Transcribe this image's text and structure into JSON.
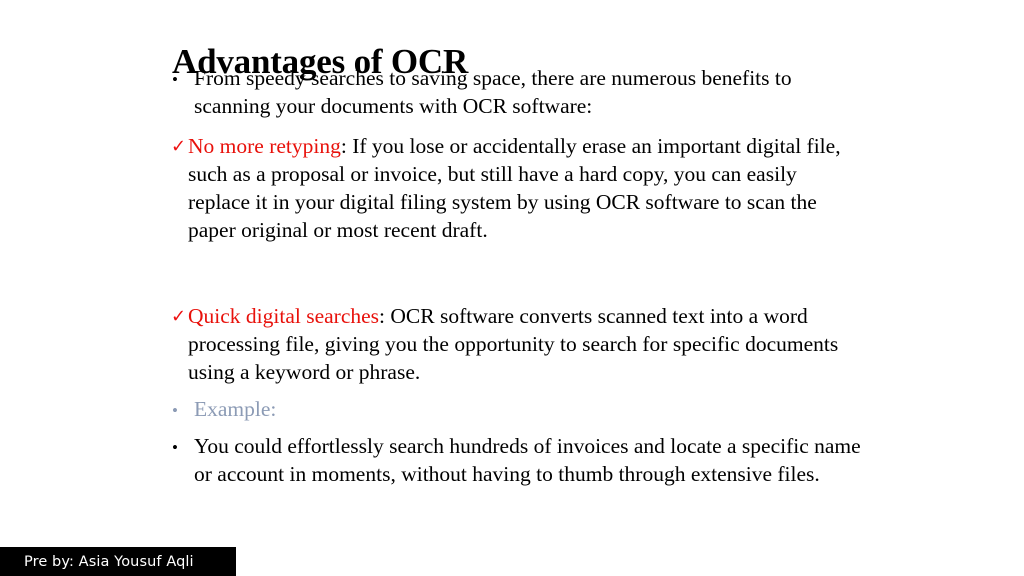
{
  "slide": {
    "title": "Advantages of OCR",
    "background_color": "#ffffff",
    "accent_red": "#e8110b",
    "muted_blue": "#8c9bb5"
  },
  "content": {
    "intro_bullet": {
      "marker": "dot-bullet",
      "text": "From speedy searches to saving space, there are numerous benefits to scanning your documents with OCR software:"
    },
    "point_one": {
      "marker": "check-bullet",
      "heading": "No more retyping",
      "separator": ": ",
      "text": "If you lose or accidentally erase an important digital file, such as a proposal or invoice, but still have a hard copy, you can easily replace it in your digital filing system by using OCR software to scan the paper original or most recent draft."
    },
    "point_two": {
      "marker": "check-bullet",
      "heading": "Quick digital searches",
      "separator": ": ",
      "text": "OCR software converts scanned text into a word processing file, giving you the opportunity to search for specific documents using a keyword or phrase."
    },
    "example_label": {
      "marker": "dot-bullet-muted",
      "text": "Example:"
    },
    "example_body": {
      "marker": "dot-bullet",
      "text": "You could effortlessly search hundreds of invoices and locate a specific name or account in moments, without having to thumb through extensive files."
    }
  },
  "footer": {
    "credit": "Pre by: Asia Yousuf Aqli",
    "background_color": "#000000",
    "text_color": "#ffffff"
  }
}
